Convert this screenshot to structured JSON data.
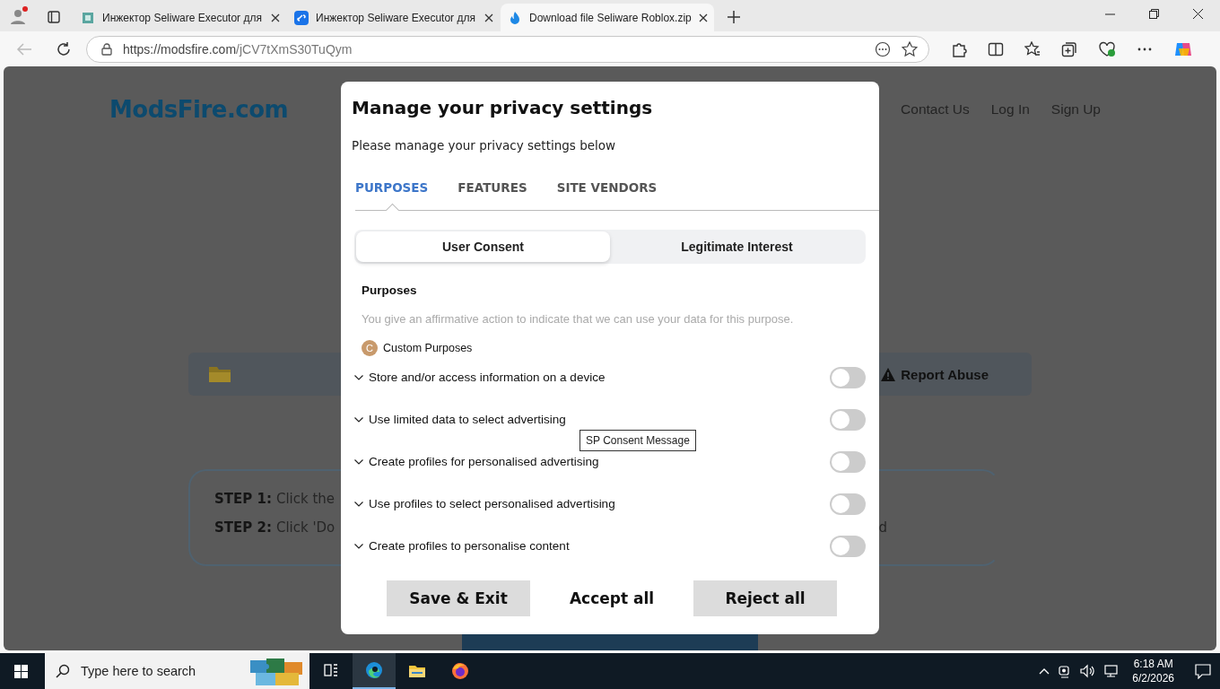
{
  "browser": {
    "tabs": [
      {
        "title": "Инжектор Seliware Executor для",
        "selected": false
      },
      {
        "title": "Инжектор Seliware Executor для",
        "selected": false
      },
      {
        "title": "Download file Seliware Roblox.zip",
        "selected": true
      }
    ],
    "url_host": "https://modsfire.com",
    "url_path": "/jCV7tXmS30TuQym"
  },
  "site": {
    "logo": "ModsFire.com",
    "nav": [
      "Contact Us",
      "Log In",
      "Sign Up"
    ],
    "report": "Report Abuse",
    "steps": [
      {
        "label": "STEP 1:",
        "text": "Click the"
      },
      {
        "label": "STEP 2:",
        "text": "Click 'Do"
      }
    ],
    "step_fragment": "d"
  },
  "modal": {
    "title": "Manage your privacy settings",
    "subtitle": "Please manage your privacy settings below",
    "tabs": [
      {
        "label": "PURPOSES",
        "selected": true
      },
      {
        "label": "FEATURES",
        "selected": false
      },
      {
        "label": "SITE VENDORS",
        "selected": false
      }
    ],
    "segments": [
      {
        "label": "User Consent",
        "selected": true
      },
      {
        "label": "Legitimate Interest",
        "selected": false
      }
    ],
    "section_title": "Purposes",
    "description": "You give an affirmative action to indicate that we can use your data for this purpose.",
    "group_badge": "C",
    "group": "Custom Purposes",
    "purposes": [
      {
        "label": "Store and/or access information on a device",
        "on": false
      },
      {
        "label": "Use limited data to select advertising",
        "on": false
      },
      {
        "label": "Create profiles for personalised advertising",
        "on": false
      },
      {
        "label": "Use profiles to select personalised advertising",
        "on": false
      },
      {
        "label": "Create profiles to personalise content",
        "on": false
      }
    ],
    "tooltip": "SP Consent Message",
    "buttons": [
      {
        "label": "Save & Exit",
        "kind": "filled"
      },
      {
        "label": "Accept all",
        "kind": "plain"
      },
      {
        "label": "Reject all",
        "kind": "filled"
      }
    ]
  },
  "taskbar": {
    "search_placeholder": "Type here to search",
    "time": "6:18 AM",
    "date": "6/2/2026"
  }
}
